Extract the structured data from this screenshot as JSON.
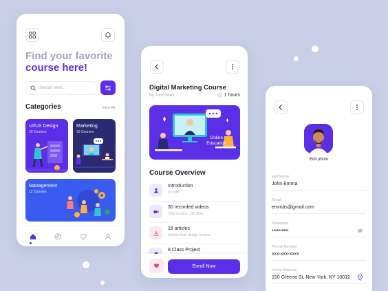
{
  "colors": {
    "background": "#c9cee6",
    "accent": "#5b2ee8",
    "title_light": "#a3a1cf"
  },
  "home": {
    "title_line1": "Find your favorite",
    "title_line2": "course here!",
    "search_placeholder": "Search here...",
    "categories_title": "Categories",
    "view_all": "View All",
    "categories": [
      {
        "name": "UI/UX Design",
        "count": "10 Courses"
      },
      {
        "name": "Marketing",
        "count": "15 Courses"
      },
      {
        "name": "Management",
        "count": "12 Courses"
      }
    ],
    "nav_icons": [
      "home-icon",
      "compass-icon",
      "heart-icon",
      "user-icon"
    ]
  },
  "course": {
    "title": "Digital Marketing Course",
    "author": "By John Mark",
    "duration": "1 hours",
    "banner_line1": "Online",
    "banner_line2": "Education",
    "overview_title": "Course Overview",
    "items": [
      {
        "title": "Introduction",
        "sub": "1h 30m",
        "icon": "user-icon"
      },
      {
        "title": "30 recorded videos",
        "sub": "Total duration 12h 30m",
        "icon": "video-icon"
      },
      {
        "title": "16 articles",
        "sub": "Articles from design leaders",
        "icon": "download-icon"
      },
      {
        "title": "8 Class Project",
        "sub": "",
        "icon": "document-icon"
      }
    ],
    "enroll_label": "Enroll Now"
  },
  "profile": {
    "edit_photo": "Edit photo",
    "fields": [
      {
        "label": "Full Name",
        "value": "John Emma"
      },
      {
        "label": "Email",
        "value": "emmas@gmail.com"
      },
      {
        "label": "Password",
        "value": "••••••••••"
      },
      {
        "label": "Phone Number",
        "value": "xxx-xxx-xxxx"
      },
      {
        "label": "Home Address",
        "value": "150 Greene St, New York, NY 10012"
      }
    ]
  }
}
